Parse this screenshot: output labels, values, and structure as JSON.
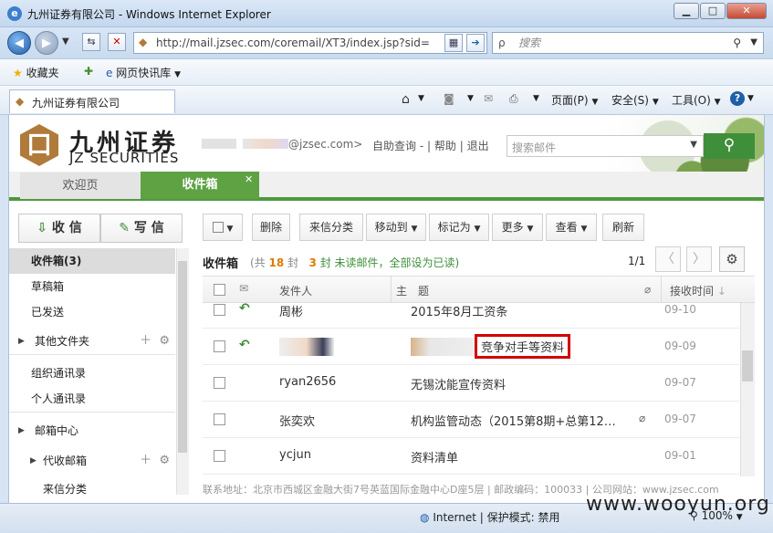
{
  "browser": {
    "window_title": "九州证券有限公司 - Windows Internet Explorer",
    "address": "http://mail.jzsec.com/coremail/XT3/index.jsp?sid=",
    "search_placeholder": "搜索",
    "favorites_label": "收藏夹",
    "quicklib_label": "网页快讯库",
    "tab_title": "九州证券有限公司",
    "menu": {
      "page": "页面(P)",
      "safety": "安全(S)",
      "tools": "工具(O)"
    },
    "status_zone": "Internet | 保护模式: 禁用",
    "zoom": "100%"
  },
  "header": {
    "logo_cn": "九州证券",
    "logo_en": "JZ SECURITIES",
    "email_domain": "@jzsec.com>",
    "links": {
      "auto": "自助查询",
      "help": "帮助",
      "logout": "退出",
      "sep1": "-",
      "sep2": "|"
    },
    "search_placeholder": "搜索邮件"
  },
  "tabs": [
    {
      "label": "欢迎页",
      "active": false
    },
    {
      "label": "收件箱",
      "active": true
    }
  ],
  "sidebar": {
    "receive": "收 信",
    "compose": "写 信",
    "items": [
      {
        "label": "收件箱(3)"
      },
      {
        "label": "草稿箱"
      },
      {
        "label": "已发送"
      },
      {
        "label": "其他文件夹"
      },
      {
        "label": "组织通讯录"
      },
      {
        "label": "个人通讯录"
      },
      {
        "label": "邮箱中心"
      },
      {
        "label": "代收邮箱"
      },
      {
        "label": "来信分类"
      }
    ]
  },
  "toolbar": {
    "delete": "删除",
    "classify": "来信分类",
    "move": "移动到",
    "mark": "标记为",
    "more": "更多",
    "view": "查看",
    "refresh": "刷新"
  },
  "inbox": {
    "title": "收件箱",
    "total_prefix": "(共",
    "total": "18",
    "total_suffix": "封",
    "unread": "3",
    "unread_suffix": "封 未读邮件",
    "mark_all": "，全部设为已读)",
    "page": "1/1"
  },
  "columns": {
    "sender": "发件人",
    "subject": "主　题",
    "date": "接收时间"
  },
  "rows": [
    {
      "sender": "周彬",
      "subject": "2015年8月工资条",
      "date": "09-10",
      "replied": true
    },
    {
      "sender": "",
      "subject": "竞争对手等资料",
      "date": "09-09",
      "replied": true
    },
    {
      "sender": "ryan2656",
      "subject": "无锡沈能宣传资料",
      "date": "09-07",
      "replied": false
    },
    {
      "sender": "张奕欢",
      "subject": "机构监管动态（2015第8期+总第12…",
      "date": "09-07",
      "replied": false,
      "attachment": true
    },
    {
      "sender": "ycjun",
      "subject": "资料清单",
      "date": "09-01",
      "replied": false
    }
  ],
  "footer": "联系地址：北京市西城区金融大街7号英蓝国际金融中心D座5层 | 邮政编码：100033 | 公司网站：www.jzsec.com",
  "watermark": "www.wooyun.org"
}
